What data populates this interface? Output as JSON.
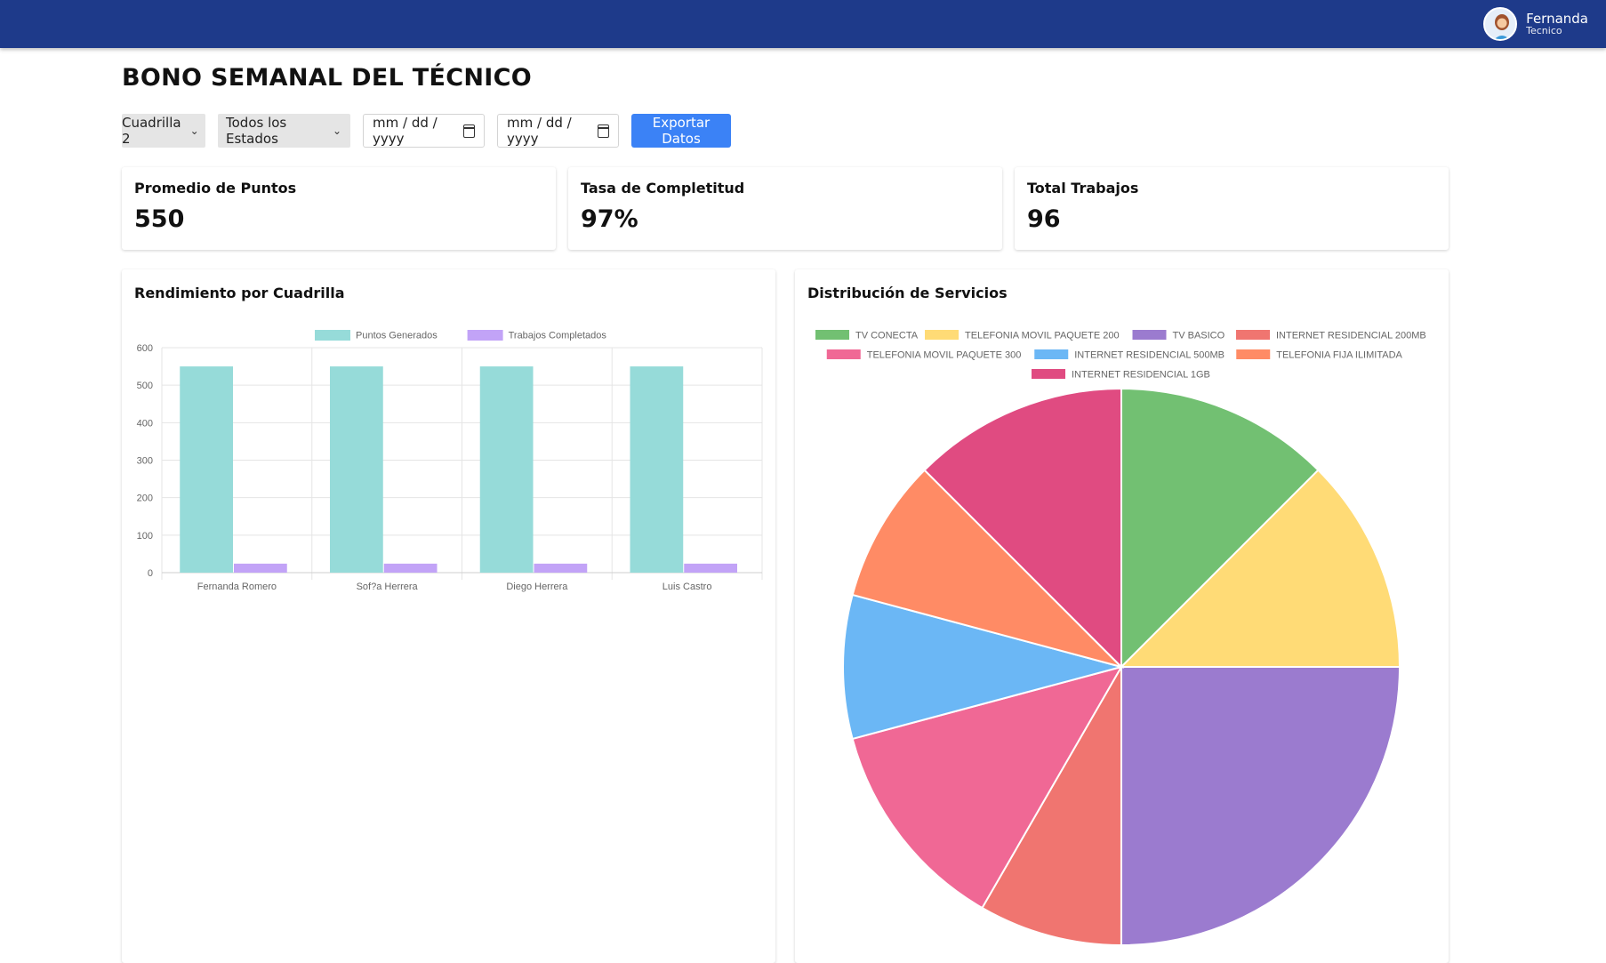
{
  "header": {
    "user_name": "Fernanda",
    "user_role": "Tecnico",
    "bar_color": "#1e3a8a"
  },
  "page": {
    "title": "BONO SEMANAL DEL TÉCNICO"
  },
  "filters": {
    "squad_selected": "Cuadrilla 2",
    "status_selected": "Todos los Estados",
    "date_from_placeholder": "mm / dd / yyyy",
    "date_to_placeholder": "mm / dd / yyyy",
    "export_label": "Exportar Datos"
  },
  "stats": [
    {
      "label": "Promedio de Puntos",
      "value": "550"
    },
    {
      "label": "Tasa de Completitud",
      "value": "97%"
    },
    {
      "label": "Total Trabajos",
      "value": "96"
    }
  ],
  "charts": {
    "bar_title": "Rendimiento por Cuadrilla",
    "pie_title": "Distribución de Servicios"
  },
  "chart_data": [
    {
      "type": "bar",
      "categories": [
        "Fernanda Romero",
        "Sof?a Herrera",
        "Diego Herrera",
        "Luis Castro"
      ],
      "series": [
        {
          "name": "Puntos Generados",
          "values": [
            550,
            550,
            550,
            550
          ],
          "color": "#96dbd9"
        },
        {
          "name": "Trabajos Completados",
          "values": [
            24,
            24,
            24,
            24
          ],
          "color": "#c2a3f7"
        }
      ],
      "ylim": [
        0,
        600
      ],
      "yticks": [
        0,
        100,
        200,
        300,
        400,
        500,
        600
      ],
      "grid": true,
      "legend": "top"
    },
    {
      "type": "pie",
      "labels": [
        "TV CONECTA",
        "TELEFONIA MOVIL PAQUETE 200",
        "TV BASICO",
        "INTERNET RESIDENCIAL 200MB",
        "TELEFONIA MOVIL PAQUETE 300",
        "INTERNET RESIDENCIAL 500MB",
        "TELEFONIA FIJA ILIMITADA",
        "INTERNET RESIDENCIAL 1GB"
      ],
      "values": [
        12.5,
        12.5,
        25,
        8.33,
        12.5,
        8.33,
        8.33,
        12.5
      ],
      "colors": [
        "#72c072",
        "#ffdb76",
        "#9b7bcf",
        "#f07570",
        "#f06895",
        "#6bb7f5",
        "#ff8b65",
        "#e04b81"
      ],
      "legend": "top"
    }
  ]
}
